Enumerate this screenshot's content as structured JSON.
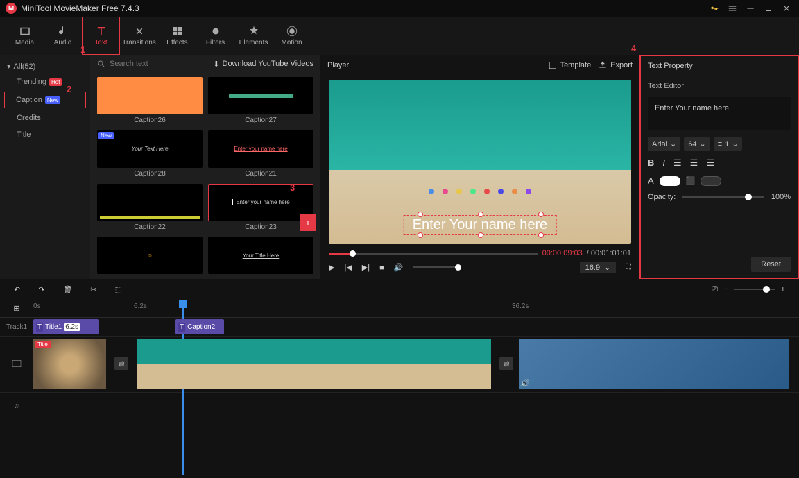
{
  "app": {
    "title": "MiniTool MovieMaker Free 7.4.3"
  },
  "toolbar": [
    {
      "id": "media",
      "label": "Media"
    },
    {
      "id": "audio",
      "label": "Audio"
    },
    {
      "id": "text",
      "label": "Text",
      "active": true
    },
    {
      "id": "transitions",
      "label": "Transitions"
    },
    {
      "id": "effects",
      "label": "Effects"
    },
    {
      "id": "filters",
      "label": "Filters"
    },
    {
      "id": "elements",
      "label": "Elements"
    },
    {
      "id": "motion",
      "label": "Motion"
    }
  ],
  "sidebar": {
    "all": "All(52)",
    "items": [
      {
        "label": "Trending",
        "badge": "Hot",
        "badgeClass": "hot"
      },
      {
        "label": "Caption",
        "badge": "New",
        "badgeClass": "new",
        "active": true
      },
      {
        "label": "Credits"
      },
      {
        "label": "Title"
      }
    ]
  },
  "gallery": {
    "search_placeholder": "Search text",
    "download": "Download YouTube Videos",
    "items": [
      {
        "label": "Caption26"
      },
      {
        "label": "Caption27"
      },
      {
        "label": "Caption28",
        "badge": "New"
      },
      {
        "label": "Caption21"
      },
      {
        "label": "Caption22"
      },
      {
        "label": "Caption23",
        "selected": true,
        "add": true,
        "preview": "Enter your name here"
      },
      {
        "label": ""
      },
      {
        "label": ""
      }
    ]
  },
  "player": {
    "title": "Player",
    "template": "Template",
    "export": "Export",
    "overlay": "Enter Your name here",
    "time_current": "00:00:09:03",
    "time_total": "00:01:01:01",
    "aspect": "16:9"
  },
  "property": {
    "title": "Text Property",
    "editor_label": "Text Editor",
    "text_value": "Enter Your name here",
    "font": "Arial",
    "size": "64",
    "line": "1",
    "opacity_label": "Opacity:",
    "opacity_value": "100%",
    "reset": "Reset"
  },
  "timeline": {
    "track1": "Track1",
    "ticks": [
      "0s",
      "6.2s",
      "36.2s"
    ],
    "clip_title": "Title1",
    "clip_title_time": "6.2s",
    "clip_caption": "Caption2",
    "title_tag": "Title"
  },
  "markers": {
    "m1": "1",
    "m2": "2",
    "m3": "3",
    "m4": "4"
  }
}
